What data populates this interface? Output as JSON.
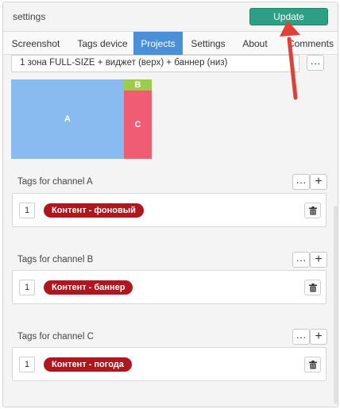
{
  "window": {
    "title": "settings"
  },
  "toolbar": {
    "update_label": "Update"
  },
  "tabs": [
    {
      "label": "Screenshot",
      "active": false
    },
    {
      "label": "Tags device",
      "active": false
    },
    {
      "label": "Projects",
      "active": true
    },
    {
      "label": "Settings",
      "active": false
    },
    {
      "label": "About",
      "active": false
    },
    {
      "label": "Comments",
      "active": false
    }
  ],
  "layout_select": {
    "value": "1 зона FULL-SIZE + виджет (верх) + баннер (низ)",
    "more_label": "···"
  },
  "layout_preview": {
    "zones": [
      {
        "label": "A",
        "color": "#89bbf0"
      },
      {
        "label": "B",
        "color": "#9ccc4c"
      },
      {
        "label": "C",
        "color": "#ef5c73"
      }
    ]
  },
  "channels": [
    {
      "label": "Tags for channel A",
      "more_label": "···",
      "add_label": "+",
      "tag_number": "1",
      "tag_name": "Контент - фоновый"
    },
    {
      "label": "Tags for channel B",
      "more_label": "···",
      "add_label": "+",
      "tag_number": "1",
      "tag_name": "Контент - баннер"
    },
    {
      "label": "Tags for channel C",
      "more_label": "···",
      "add_label": "+",
      "tag_number": "1",
      "tag_name": "Контент - погода"
    }
  ],
  "colors": {
    "accent": "#2e9e84",
    "active_tab": "#4a8fd8",
    "tag": "#b0161d",
    "annotation_arrow": "#e0403a"
  },
  "icons": {
    "trash": "trash-icon",
    "arrow": "red-arrow-annotation"
  }
}
